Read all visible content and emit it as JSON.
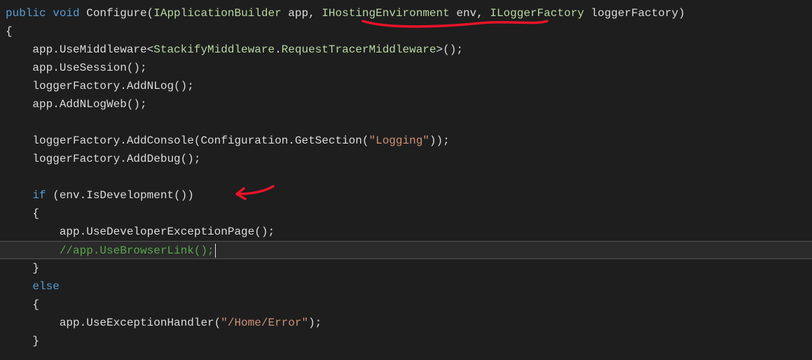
{
  "code": {
    "l1_public": "public",
    "l1_void": "void",
    "l1_name": " Configure(",
    "l1_t1": "IApplicationBuilder",
    "l1_a1": " app, ",
    "l1_t2": "IHostingEnvironment",
    "l1_a2": " env, ",
    "l1_t3": "ILoggerFactory",
    "l1_a3": " loggerFactory)",
    "l2": "{",
    "l3a": "    app.UseMiddleware<",
    "l3b": "StackifyMiddleware",
    "l3c": ".",
    "l3d": "RequestTracerMiddleware",
    "l3e": ">();",
    "l4": "    app.UseSession();",
    "l5": "    loggerFactory.AddNLog();",
    "l6": "    app.AddNLogWeb();",
    "l7": "",
    "l8a": "    loggerFactory.AddConsole(Configuration.GetSection(",
    "l8s": "\"Logging\"",
    "l8b": "));",
    "l9": "    loggerFactory.AddDebug();",
    "l10": "",
    "l11_if": "    if",
    "l11_rest": " (env.IsDevelopment())",
    "l12": "    {",
    "l13": "        app.UseDeveloperExceptionPage();",
    "l14": "        //app.UseBrowserLink();",
    "l15": "    }",
    "l16": "    else",
    "l17": "    {",
    "l18a": "        app.UseExceptionHandler(",
    "l18s": "\"/Home/Error\"",
    "l18b": ");",
    "l19": "    }"
  },
  "annotations": {
    "underline_color": "#e8132a",
    "arrow_color": "#e8132a"
  }
}
